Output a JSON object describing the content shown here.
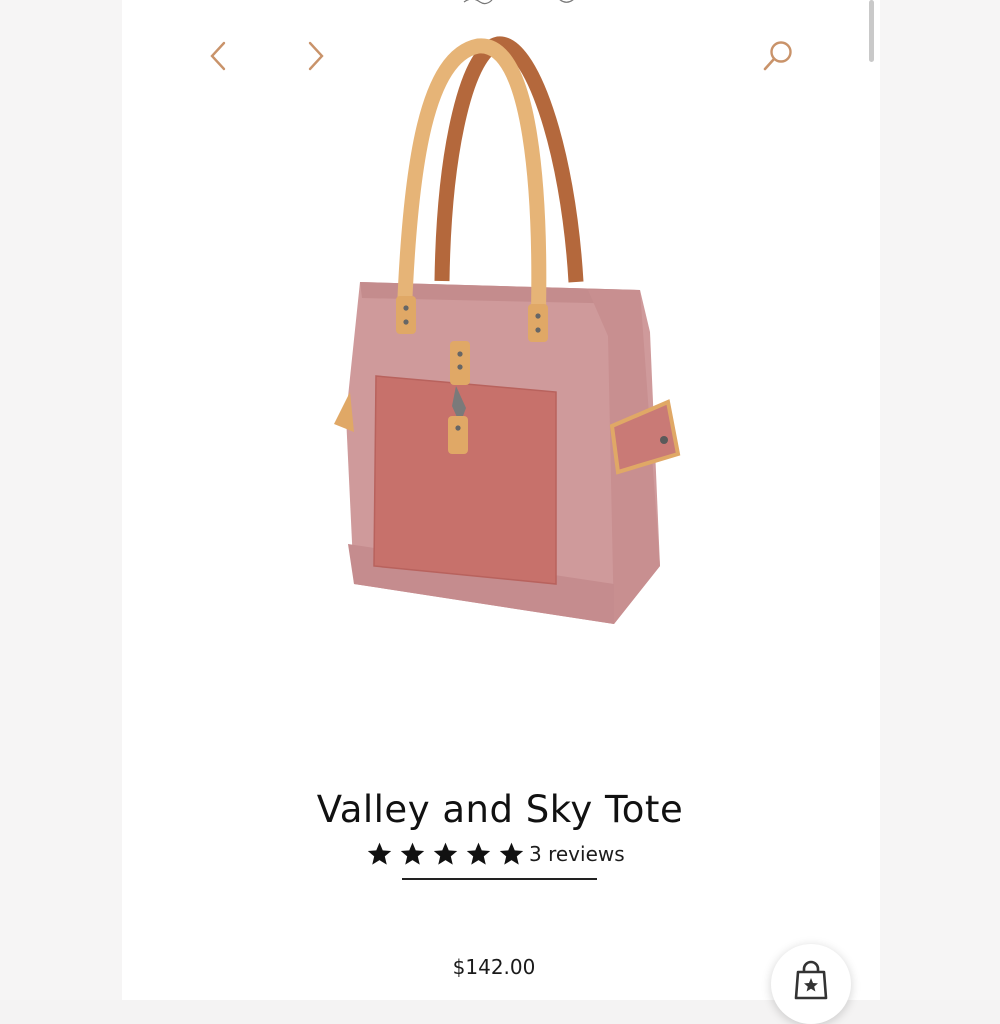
{
  "product": {
    "title": "Valley and Sky Tote",
    "rating_stars": 5,
    "reviews_label": "3 reviews",
    "price": "$142.00"
  },
  "icons": {
    "prev": "chevron-left-icon",
    "next": "chevron-right-icon",
    "search": "search-icon",
    "cart": "shopping-bag-star-icon"
  },
  "colors": {
    "accent": "#c9936a",
    "bag_body": "#cf9a9b",
    "bag_pocket": "#c7716b",
    "leather": "#e0a866"
  }
}
